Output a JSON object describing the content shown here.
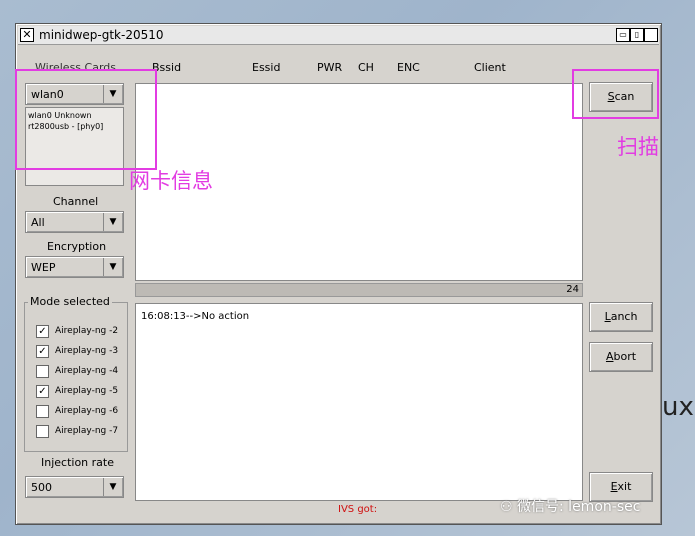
{
  "window": {
    "title": "minidwep-gtk-20510",
    "icon_close": "close-icon"
  },
  "columns": [
    "Bssid",
    "Essid",
    "PWR",
    "CH",
    "ENC",
    "Client"
  ],
  "wireless_cards": {
    "label": "Wireless Cards",
    "selected": "wlan0",
    "info_line1": "wlan0 Unknown",
    "info_line2": "rt2800usb - [phy0]"
  },
  "channel": {
    "label": "Channel",
    "value": "All"
  },
  "encryption": {
    "label": "Encryption",
    "value": "WEP"
  },
  "mode": {
    "label": "Mode selected",
    "items": [
      {
        "label": "Aireplay-ng -2",
        "checked": true
      },
      {
        "label": "Aireplay-ng -3",
        "checked": true
      },
      {
        "label": "Aireplay-ng -4",
        "checked": false
      },
      {
        "label": "Aireplay-ng -5",
        "checked": true
      },
      {
        "label": "Aireplay-ng -6",
        "checked": false
      },
      {
        "label": "Aireplay-ng -7",
        "checked": false
      }
    ]
  },
  "injection": {
    "label": "Injection rate",
    "value": "500"
  },
  "counter": "24",
  "log_line": "16:08:13-->No action",
  "ivs_label": "IVS got:",
  "buttons": {
    "scan_first": "S",
    "scan_rest": "can",
    "lanch_first": "L",
    "lanch_rest": "anch",
    "abort_first": "A",
    "abort_rest": "bort",
    "exit_first": "E",
    "exit_rest": "xit"
  },
  "annotations": {
    "card_info": "网卡信息",
    "scan": "扫描"
  },
  "background_text": "ux",
  "watermark": "微信号: lemon-sec",
  "colors": {
    "annotation": "#e23ce2",
    "ivs": "#d01010"
  }
}
